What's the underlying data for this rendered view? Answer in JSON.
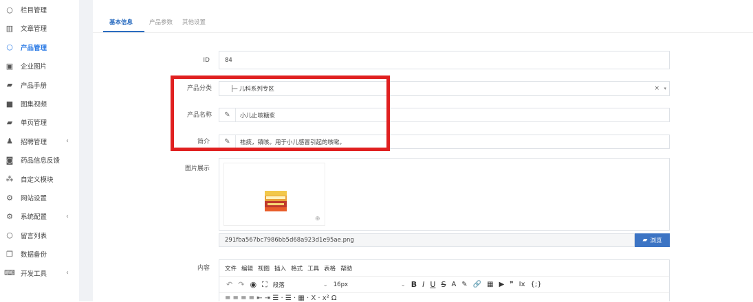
{
  "sidebar": {
    "items": [
      {
        "label": "栏目管理",
        "icon": "circle-icon",
        "glyph": "○",
        "active": false,
        "chevron": ""
      },
      {
        "label": "文章管理",
        "icon": "bar-chart-icon",
        "glyph": "▥",
        "active": false,
        "chevron": ""
      },
      {
        "label": "产品管理",
        "icon": "circle-icon",
        "glyph": "○",
        "active": true,
        "chevron": ""
      },
      {
        "label": "企业图片",
        "icon": "image-icon",
        "glyph": "▣",
        "active": false,
        "chevron": ""
      },
      {
        "label": "产品手册",
        "icon": "book-icon",
        "glyph": "▰",
        "active": false,
        "chevron": ""
      },
      {
        "label": "图集视频",
        "icon": "video-icon",
        "glyph": "■",
        "active": false,
        "chevron": ""
      },
      {
        "label": "单页管理",
        "icon": "book-icon",
        "glyph": "▰",
        "active": false,
        "chevron": ""
      },
      {
        "label": "招聘管理",
        "icon": "user-icon",
        "glyph": "♟",
        "active": false,
        "chevron": "‹"
      },
      {
        "label": "药品信息反馈",
        "icon": "camera-icon",
        "glyph": "◙",
        "active": false,
        "chevron": ""
      },
      {
        "label": "自定义模块",
        "icon": "cubes-icon",
        "glyph": "⁂",
        "active": false,
        "chevron": ""
      },
      {
        "label": "网站设置",
        "icon": "cogs-icon",
        "glyph": "⚙",
        "active": false,
        "chevron": ""
      },
      {
        "label": "系统配置",
        "icon": "gear-icon",
        "glyph": "⚙",
        "active": false,
        "chevron": "‹"
      },
      {
        "label": "留言列表",
        "icon": "circle-icon",
        "glyph": "○",
        "active": false,
        "chevron": ""
      },
      {
        "label": "数据备份",
        "icon": "copy-icon",
        "glyph": "❐",
        "active": false,
        "chevron": ""
      },
      {
        "label": "开发工具",
        "icon": "keyboard-icon",
        "glyph": "⌨",
        "active": false,
        "chevron": "‹"
      }
    ]
  },
  "tabs": [
    {
      "label": "基本信息",
      "active": true
    },
    {
      "label": "产品参数",
      "active": false
    },
    {
      "label": "其他设置",
      "active": false
    }
  ],
  "form": {
    "id": {
      "label": "ID",
      "value": "84"
    },
    "category": {
      "label": "产品分类",
      "value": "├─ 儿科系列专区",
      "clear": "×",
      "caret": "▾"
    },
    "name": {
      "label": "产品名称",
      "value": "小儿止咳糖浆"
    },
    "intro": {
      "label": "简介",
      "value": "祛痰，镇咳。用于小儿感冒引起的咳嗽。"
    },
    "images": {
      "label": "图片展示",
      "filename": "291fba567bc7986bb5d68a923d1e95ae.png",
      "browse_label": "浏览",
      "zoom_glyph": "⊕"
    },
    "content": {
      "label": "内容"
    }
  },
  "editor": {
    "menu": [
      "文件",
      "编辑",
      "视图",
      "插入",
      "格式",
      "工具",
      "表格",
      "帮助"
    ],
    "block_format": "段落",
    "font_size": "16px",
    "toolbar_glyphs": [
      "↶",
      "↷",
      "◉",
      "⛶"
    ],
    "format_glyphs": [
      "B",
      "I",
      "U",
      "S",
      "A",
      "✎",
      "🔗",
      "▦",
      "▶",
      "❞",
      "Ix",
      "{;}"
    ],
    "row2_glyphs": "≡  ≡  ≡  ≡   ⇤  ⇥  ☰ ·  ☰ ·  ▦ ·  X ·  x²  Ω"
  },
  "colors": {
    "accent": "#2a6cc0",
    "highlight": "#e02020",
    "button": "#3c74c4"
  }
}
